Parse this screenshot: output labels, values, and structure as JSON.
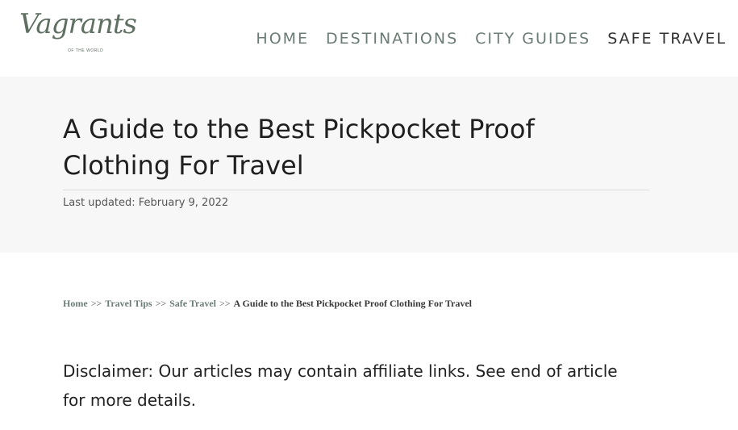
{
  "logo": {
    "script_text": "Vagrants",
    "tagline": "OF THE WORLD"
  },
  "nav": {
    "items": [
      {
        "label": "HOME"
      },
      {
        "label": "DESTINATIONS"
      },
      {
        "label": "CITY GUIDES"
      },
      {
        "label": "SAFE TRAVEL"
      }
    ]
  },
  "article": {
    "title": "A Guide to the Best Pickpocket Proof Clothing For Travel",
    "last_updated": "Last updated: February 9, 2022"
  },
  "breadcrumb": {
    "items": [
      "Home",
      "Travel Tips",
      "Safe Travel"
    ],
    "separator": ">>",
    "current": "A Guide to the Best Pickpocket Proof Clothing For Travel"
  },
  "disclaimer": "Disclaimer: Our articles may contain affiliate links. See end of article for more details.",
  "colors": {
    "accent": "#6b7c75",
    "hero_bg": "#f7f7f7",
    "logo": "#5f6f62"
  }
}
